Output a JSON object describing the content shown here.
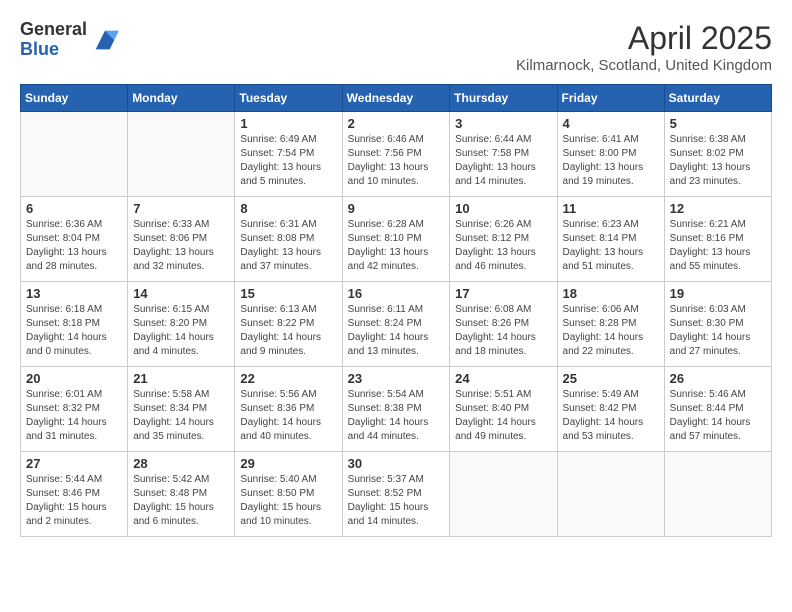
{
  "logo": {
    "general": "General",
    "blue": "Blue"
  },
  "title": "April 2025",
  "subtitle": "Kilmarnock, Scotland, United Kingdom",
  "days_of_week": [
    "Sunday",
    "Monday",
    "Tuesday",
    "Wednesday",
    "Thursday",
    "Friday",
    "Saturday"
  ],
  "weeks": [
    [
      {
        "day": "",
        "info": ""
      },
      {
        "day": "",
        "info": ""
      },
      {
        "day": "1",
        "info": "Sunrise: 6:49 AM\nSunset: 7:54 PM\nDaylight: 13 hours and 5 minutes."
      },
      {
        "day": "2",
        "info": "Sunrise: 6:46 AM\nSunset: 7:56 PM\nDaylight: 13 hours and 10 minutes."
      },
      {
        "day": "3",
        "info": "Sunrise: 6:44 AM\nSunset: 7:58 PM\nDaylight: 13 hours and 14 minutes."
      },
      {
        "day": "4",
        "info": "Sunrise: 6:41 AM\nSunset: 8:00 PM\nDaylight: 13 hours and 19 minutes."
      },
      {
        "day": "5",
        "info": "Sunrise: 6:38 AM\nSunset: 8:02 PM\nDaylight: 13 hours and 23 minutes."
      }
    ],
    [
      {
        "day": "6",
        "info": "Sunrise: 6:36 AM\nSunset: 8:04 PM\nDaylight: 13 hours and 28 minutes."
      },
      {
        "day": "7",
        "info": "Sunrise: 6:33 AM\nSunset: 8:06 PM\nDaylight: 13 hours and 32 minutes."
      },
      {
        "day": "8",
        "info": "Sunrise: 6:31 AM\nSunset: 8:08 PM\nDaylight: 13 hours and 37 minutes."
      },
      {
        "day": "9",
        "info": "Sunrise: 6:28 AM\nSunset: 8:10 PM\nDaylight: 13 hours and 42 minutes."
      },
      {
        "day": "10",
        "info": "Sunrise: 6:26 AM\nSunset: 8:12 PM\nDaylight: 13 hours and 46 minutes."
      },
      {
        "day": "11",
        "info": "Sunrise: 6:23 AM\nSunset: 8:14 PM\nDaylight: 13 hours and 51 minutes."
      },
      {
        "day": "12",
        "info": "Sunrise: 6:21 AM\nSunset: 8:16 PM\nDaylight: 13 hours and 55 minutes."
      }
    ],
    [
      {
        "day": "13",
        "info": "Sunrise: 6:18 AM\nSunset: 8:18 PM\nDaylight: 14 hours and 0 minutes."
      },
      {
        "day": "14",
        "info": "Sunrise: 6:15 AM\nSunset: 8:20 PM\nDaylight: 14 hours and 4 minutes."
      },
      {
        "day": "15",
        "info": "Sunrise: 6:13 AM\nSunset: 8:22 PM\nDaylight: 14 hours and 9 minutes."
      },
      {
        "day": "16",
        "info": "Sunrise: 6:11 AM\nSunset: 8:24 PM\nDaylight: 14 hours and 13 minutes."
      },
      {
        "day": "17",
        "info": "Sunrise: 6:08 AM\nSunset: 8:26 PM\nDaylight: 14 hours and 18 minutes."
      },
      {
        "day": "18",
        "info": "Sunrise: 6:06 AM\nSunset: 8:28 PM\nDaylight: 14 hours and 22 minutes."
      },
      {
        "day": "19",
        "info": "Sunrise: 6:03 AM\nSunset: 8:30 PM\nDaylight: 14 hours and 27 minutes."
      }
    ],
    [
      {
        "day": "20",
        "info": "Sunrise: 6:01 AM\nSunset: 8:32 PM\nDaylight: 14 hours and 31 minutes."
      },
      {
        "day": "21",
        "info": "Sunrise: 5:58 AM\nSunset: 8:34 PM\nDaylight: 14 hours and 35 minutes."
      },
      {
        "day": "22",
        "info": "Sunrise: 5:56 AM\nSunset: 8:36 PM\nDaylight: 14 hours and 40 minutes."
      },
      {
        "day": "23",
        "info": "Sunrise: 5:54 AM\nSunset: 8:38 PM\nDaylight: 14 hours and 44 minutes."
      },
      {
        "day": "24",
        "info": "Sunrise: 5:51 AM\nSunset: 8:40 PM\nDaylight: 14 hours and 49 minutes."
      },
      {
        "day": "25",
        "info": "Sunrise: 5:49 AM\nSunset: 8:42 PM\nDaylight: 14 hours and 53 minutes."
      },
      {
        "day": "26",
        "info": "Sunrise: 5:46 AM\nSunset: 8:44 PM\nDaylight: 14 hours and 57 minutes."
      }
    ],
    [
      {
        "day": "27",
        "info": "Sunrise: 5:44 AM\nSunset: 8:46 PM\nDaylight: 15 hours and 2 minutes."
      },
      {
        "day": "28",
        "info": "Sunrise: 5:42 AM\nSunset: 8:48 PM\nDaylight: 15 hours and 6 minutes."
      },
      {
        "day": "29",
        "info": "Sunrise: 5:40 AM\nSunset: 8:50 PM\nDaylight: 15 hours and 10 minutes."
      },
      {
        "day": "30",
        "info": "Sunrise: 5:37 AM\nSunset: 8:52 PM\nDaylight: 15 hours and 14 minutes."
      },
      {
        "day": "",
        "info": ""
      },
      {
        "day": "",
        "info": ""
      },
      {
        "day": "",
        "info": ""
      }
    ]
  ]
}
